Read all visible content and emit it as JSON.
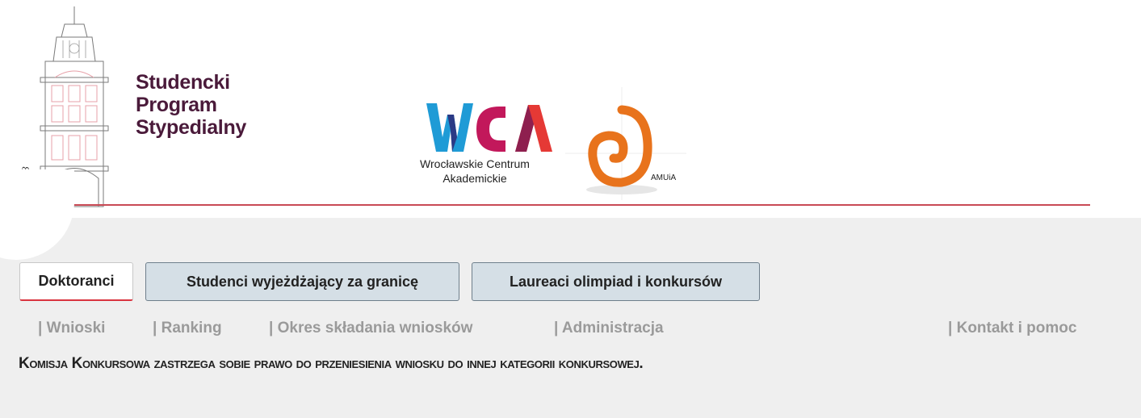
{
  "header": {
    "building_logo": {
      "icon": "building-facade-logo",
      "signature_text": "Rynek 13",
      "line_color": "#e7a0a8"
    },
    "program_title": [
      "Studencki",
      "Program",
      "Stypedialny"
    ],
    "title_color": "#4a1a3a",
    "wca_logo": {
      "mark": "WCA",
      "caption_line1": "Wrocławskie Centrum",
      "caption_line2": "Akademickie"
    },
    "amuia_logo": {
      "icon": "orange-spiral-logo",
      "label": "AMUiA",
      "color": "#e8731c"
    },
    "divider_color": "#c94a55"
  },
  "tabs": [
    {
      "label": "Doktoranci",
      "active": true
    },
    {
      "label": "Studenci wyjeżdżający za granicę",
      "active": false
    },
    {
      "label": "Laureaci olimpiad i konkursów",
      "active": false
    }
  ],
  "nav_links": [
    "| Wnioski",
    "| Ranking",
    "| Okres składania wniosków",
    "| Administracja",
    "| Kontakt i pomoc"
  ],
  "notice": "Komisja Konkursowa zastrzega sobie prawo do przeniesienia wniosku do innej kategorii konkursowej."
}
